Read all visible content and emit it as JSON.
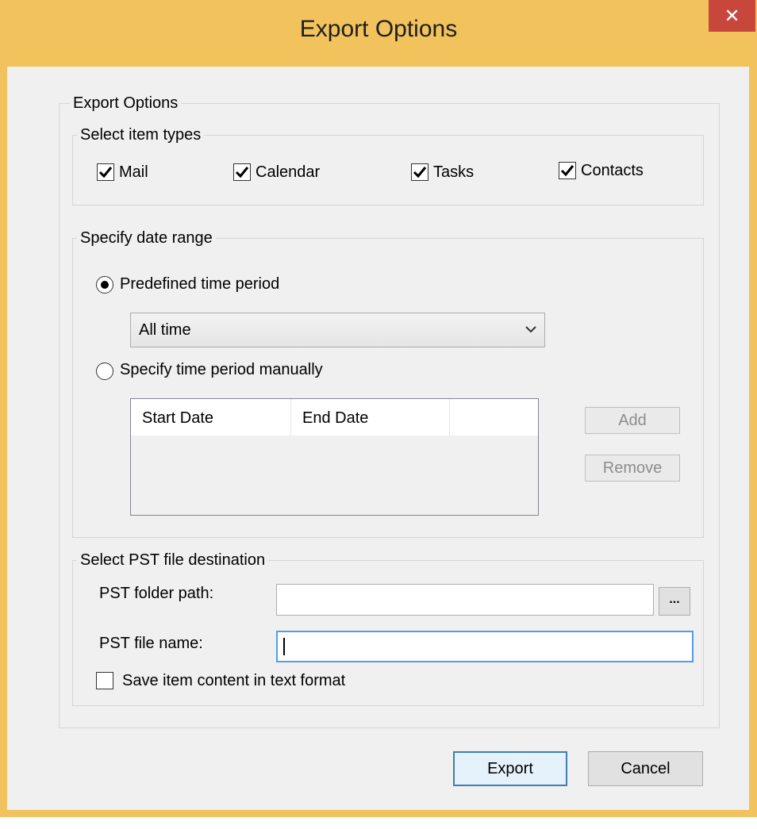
{
  "window": {
    "title": "Export Options",
    "close_label": "✕"
  },
  "export_options": {
    "group_label": "Export Options",
    "item_types": {
      "group_label": "Select item types",
      "items": [
        {
          "label": "Mail",
          "checked": true
        },
        {
          "label": "Calendar",
          "checked": true
        },
        {
          "label": "Tasks",
          "checked": true
        },
        {
          "label": "Contacts",
          "checked": true
        }
      ]
    },
    "date_range": {
      "group_label": "Specify date range",
      "predefined_label": "Predefined time period",
      "predefined_selected": true,
      "period_select_value": "All time",
      "manual_label": "Specify time period manually",
      "manual_selected": false,
      "table_columns": [
        "Start Date",
        "End Date",
        ""
      ],
      "add_button": "Add",
      "remove_button": "Remove"
    },
    "destination": {
      "group_label": "Select PST file destination",
      "folder_path_label": "PST folder path:",
      "folder_path_value": "",
      "browse_button": "...",
      "file_name_label": "PST file name:",
      "file_name_value": "",
      "text_format_label": "Save item content in text format",
      "text_format_checked": false
    }
  },
  "buttons": {
    "export": "Export",
    "cancel": "Cancel"
  },
  "colors": {
    "title_bar": "#f2c25c",
    "close_button": "#c7473d",
    "dialog_background": "#f0f0f0",
    "focus_border": "#569de5"
  }
}
